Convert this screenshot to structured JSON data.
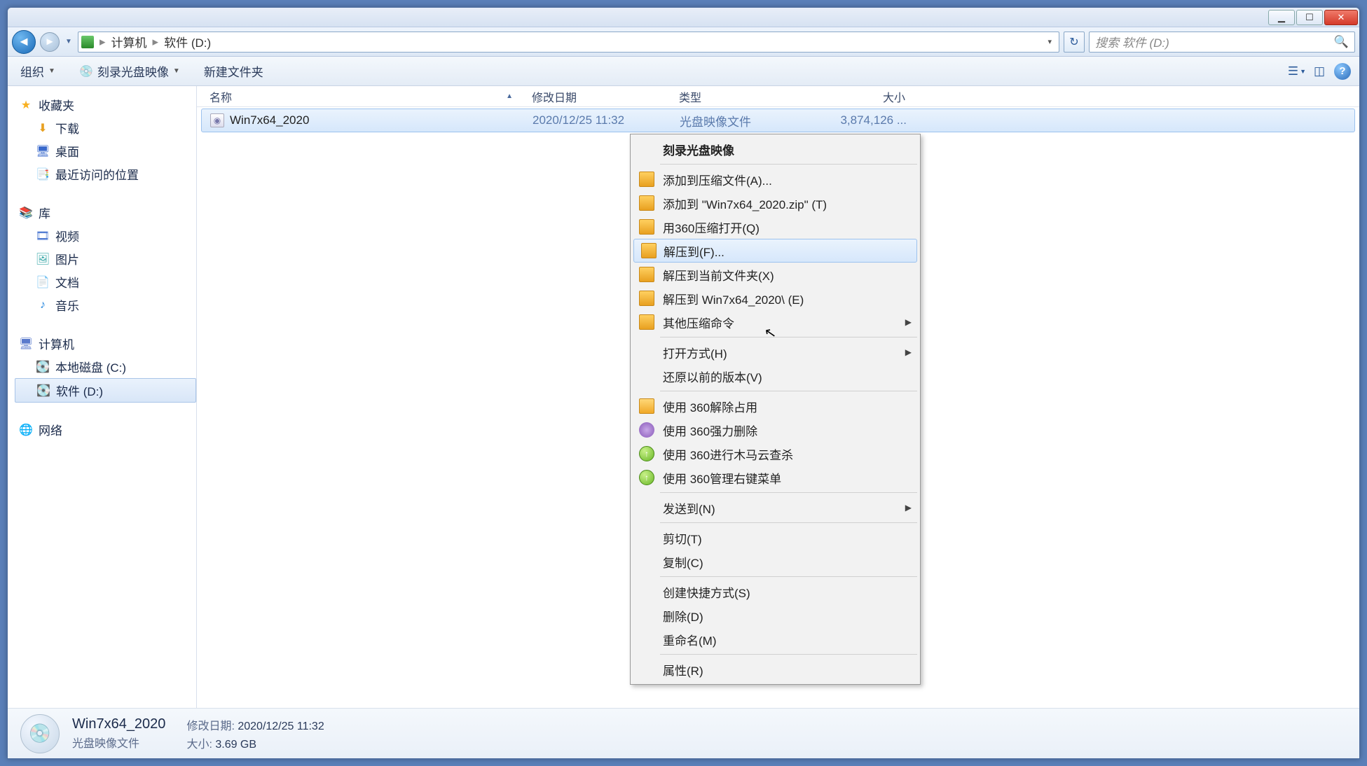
{
  "window_controls": {
    "min": "▁",
    "max": "☐",
    "close": "✕"
  },
  "breadcrumb": {
    "root": "计算机",
    "current": "软件 (D:)"
  },
  "search": {
    "placeholder": "搜索 软件 (D:)"
  },
  "toolbar": {
    "organize": "组织",
    "burn": "刻录光盘映像",
    "new_folder": "新建文件夹"
  },
  "sidebar": {
    "favorites": {
      "label": "收藏夹",
      "items": [
        {
          "label": "下载",
          "icon": "download-icon",
          "glyph": "⬇",
          "color": "#e8a020"
        },
        {
          "label": "桌面",
          "icon": "desktop-icon",
          "glyph": "🖥",
          "color": "#3a6acc"
        },
        {
          "label": "最近访问的位置",
          "icon": "recent-icon",
          "glyph": "📑",
          "color": "#7a8aa0"
        }
      ]
    },
    "libraries": {
      "label": "库",
      "items": [
        {
          "label": "视频",
          "icon": "video-icon",
          "glyph": "🎞",
          "color": "#3a6acc"
        },
        {
          "label": "图片",
          "icon": "pictures-icon",
          "glyph": "🖼",
          "color": "#3aa8a8"
        },
        {
          "label": "文档",
          "icon": "documents-icon",
          "glyph": "📄",
          "color": "#7a8aa0"
        },
        {
          "label": "音乐",
          "icon": "music-icon",
          "glyph": "♪",
          "color": "#2a8ae0"
        }
      ]
    },
    "computer": {
      "label": "计算机",
      "items": [
        {
          "label": "本地磁盘 (C:)",
          "icon": "drive-icon",
          "glyph": "💽",
          "color": "#6a8acc"
        },
        {
          "label": "软件 (D:)",
          "icon": "drive-icon",
          "glyph": "💽",
          "color": "#2a9a4a",
          "selected": true
        }
      ]
    },
    "network": {
      "label": "网络"
    }
  },
  "columns": {
    "name": "名称",
    "date": "修改日期",
    "type": "类型",
    "size": "大小"
  },
  "files": [
    {
      "name": "Win7x64_2020",
      "date": "2020/12/25 11:32",
      "type": "光盘映像文件",
      "size": "3,874,126 ...",
      "selected": true
    }
  ],
  "context_menu": {
    "items": [
      {
        "label": "刻录光盘映像",
        "bold": true
      },
      {
        "sep": true
      },
      {
        "label": "添加到压缩文件(A)...",
        "icon": "zip"
      },
      {
        "label": "添加到 \"Win7x64_2020.zip\" (T)",
        "icon": "zip"
      },
      {
        "label": "用360压缩打开(Q)",
        "icon": "zip"
      },
      {
        "label": "解压到(F)...",
        "icon": "zip",
        "hover": true
      },
      {
        "label": "解压到当前文件夹(X)",
        "icon": "zip"
      },
      {
        "label": "解压到 Win7x64_2020\\ (E)",
        "icon": "zip"
      },
      {
        "label": "其他压缩命令",
        "icon": "zip",
        "submenu": true
      },
      {
        "sep": true
      },
      {
        "label": "打开方式(H)",
        "submenu": true
      },
      {
        "label": "还原以前的版本(V)"
      },
      {
        "sep": true
      },
      {
        "label": "使用 360解除占用",
        "icon": "orange"
      },
      {
        "label": "使用 360强力删除",
        "icon": "purple"
      },
      {
        "label": "使用 360进行木马云查杀",
        "icon": "green"
      },
      {
        "label": "使用 360管理右键菜单",
        "icon": "green"
      },
      {
        "sep": true
      },
      {
        "label": "发送到(N)",
        "submenu": true
      },
      {
        "sep": true
      },
      {
        "label": "剪切(T)"
      },
      {
        "label": "复制(C)"
      },
      {
        "sep": true
      },
      {
        "label": "创建快捷方式(S)"
      },
      {
        "label": "删除(D)"
      },
      {
        "label": "重命名(M)"
      },
      {
        "sep": true
      },
      {
        "label": "属性(R)"
      }
    ]
  },
  "details": {
    "title": "Win7x64_2020",
    "subtitle": "光盘映像文件",
    "date_label": "修改日期:",
    "date_value": "2020/12/25 11:32",
    "size_label": "大小:",
    "size_value": "3.69 GB"
  }
}
